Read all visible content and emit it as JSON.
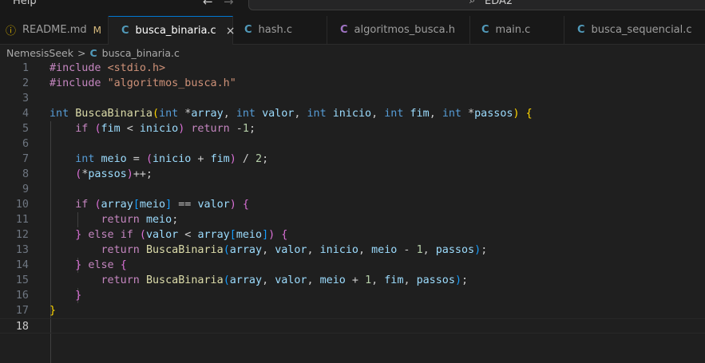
{
  "titlebar": {
    "menu_help": "Help",
    "back_icon": "←",
    "forward_icon": "→",
    "search_icon": "⌕",
    "command_center_text": "EDA2"
  },
  "tabs": [
    {
      "icon": "ⓘ",
      "label": "README.md",
      "badge": "M"
    },
    {
      "icon": "C",
      "label": "busca_binaria.c",
      "close": "×"
    },
    {
      "icon": "C",
      "label": "hash.c"
    },
    {
      "icon": "C",
      "label": "algoritmos_busca.h"
    },
    {
      "icon": "C",
      "label": "main.c"
    },
    {
      "icon": "C",
      "label": "busca_sequencial.c"
    }
  ],
  "breadcrumb": {
    "folder": "NemesisSeek",
    "separator": ">",
    "file_icon": "C",
    "file": "busca_binaria.c"
  },
  "editor": {
    "current_line": 18,
    "lines": [
      [
        [
          "#include ",
          "pre"
        ],
        [
          "<stdio.h>",
          "inc"
        ]
      ],
      [
        [
          "#include ",
          "pre"
        ],
        [
          "\"algoritmos_busca.h\"",
          "inc"
        ]
      ],
      [],
      [
        [
          "int",
          "kw"
        ],
        [
          " ",
          "txt"
        ],
        [
          "BuscaBinaria",
          "fn"
        ],
        [
          "(",
          "p1"
        ],
        [
          "int",
          "kw"
        ],
        [
          " *",
          "txt"
        ],
        [
          "array",
          "var"
        ],
        [
          ", ",
          "txt"
        ],
        [
          "int",
          "kw"
        ],
        [
          " ",
          "txt"
        ],
        [
          "valor",
          "var"
        ],
        [
          ", ",
          "txt"
        ],
        [
          "int",
          "kw"
        ],
        [
          " ",
          "txt"
        ],
        [
          "inicio",
          "var"
        ],
        [
          ", ",
          "txt"
        ],
        [
          "int",
          "kw"
        ],
        [
          " ",
          "txt"
        ],
        [
          "fim",
          "var"
        ],
        [
          ", ",
          "txt"
        ],
        [
          "int",
          "kw"
        ],
        [
          " *",
          "txt"
        ],
        [
          "passos",
          "var"
        ],
        [
          ")",
          "p1"
        ],
        [
          " ",
          "txt"
        ],
        [
          "{",
          "p1"
        ]
      ],
      [
        [
          "    ",
          "txt"
        ],
        [
          "if",
          "ctl"
        ],
        [
          " ",
          "txt"
        ],
        [
          "(",
          "p2"
        ],
        [
          "fim",
          "var"
        ],
        [
          " < ",
          "txt"
        ],
        [
          "inicio",
          "var"
        ],
        [
          ")",
          "p2"
        ],
        [
          " ",
          "txt"
        ],
        [
          "return",
          "ctl"
        ],
        [
          " -",
          "txt"
        ],
        [
          "1",
          "num"
        ],
        [
          ";",
          "txt"
        ]
      ],
      [],
      [
        [
          "    ",
          "txt"
        ],
        [
          "int",
          "kw"
        ],
        [
          " ",
          "txt"
        ],
        [
          "meio",
          "var"
        ],
        [
          " = ",
          "txt"
        ],
        [
          "(",
          "p2"
        ],
        [
          "inicio",
          "var"
        ],
        [
          " + ",
          "txt"
        ],
        [
          "fim",
          "var"
        ],
        [
          ")",
          "p2"
        ],
        [
          " / ",
          "txt"
        ],
        [
          "2",
          "num"
        ],
        [
          ";",
          "txt"
        ]
      ],
      [
        [
          "    ",
          "txt"
        ],
        [
          "(",
          "p2"
        ],
        [
          "*",
          "txt"
        ],
        [
          "passos",
          "var"
        ],
        [
          ")",
          "p2"
        ],
        [
          "++;",
          "txt"
        ]
      ],
      [],
      [
        [
          "    ",
          "txt"
        ],
        [
          "if",
          "ctl"
        ],
        [
          " ",
          "txt"
        ],
        [
          "(",
          "p2"
        ],
        [
          "array",
          "var"
        ],
        [
          "[",
          "p3"
        ],
        [
          "meio",
          "var"
        ],
        [
          "]",
          "p3"
        ],
        [
          " == ",
          "txt"
        ],
        [
          "valor",
          "var"
        ],
        [
          ")",
          "p2"
        ],
        [
          " ",
          "txt"
        ],
        [
          "{",
          "p2"
        ]
      ],
      [
        [
          "        ",
          "txt"
        ],
        [
          "return",
          "ctl"
        ],
        [
          " ",
          "txt"
        ],
        [
          "meio",
          "var"
        ],
        [
          ";",
          "txt"
        ]
      ],
      [
        [
          "    ",
          "txt"
        ],
        [
          "}",
          "p2"
        ],
        [
          " ",
          "txt"
        ],
        [
          "else",
          "ctl"
        ],
        [
          " ",
          "txt"
        ],
        [
          "if",
          "ctl"
        ],
        [
          " ",
          "txt"
        ],
        [
          "(",
          "p2"
        ],
        [
          "valor",
          "var"
        ],
        [
          " < ",
          "txt"
        ],
        [
          "array",
          "var"
        ],
        [
          "[",
          "p3"
        ],
        [
          "meio",
          "var"
        ],
        [
          "]",
          "p3"
        ],
        [
          ")",
          "p2"
        ],
        [
          " ",
          "txt"
        ],
        [
          "{",
          "p2"
        ]
      ],
      [
        [
          "        ",
          "txt"
        ],
        [
          "return",
          "ctl"
        ],
        [
          " ",
          "txt"
        ],
        [
          "BuscaBinaria",
          "fn"
        ],
        [
          "(",
          "p3"
        ],
        [
          "array",
          "var"
        ],
        [
          ", ",
          "txt"
        ],
        [
          "valor",
          "var"
        ],
        [
          ", ",
          "txt"
        ],
        [
          "inicio",
          "var"
        ],
        [
          ", ",
          "txt"
        ],
        [
          "meio",
          "var"
        ],
        [
          " - ",
          "txt"
        ],
        [
          "1",
          "num"
        ],
        [
          ", ",
          "txt"
        ],
        [
          "passos",
          "var"
        ],
        [
          ")",
          "p3"
        ],
        [
          ";",
          "txt"
        ]
      ],
      [
        [
          "    ",
          "txt"
        ],
        [
          "}",
          "p2"
        ],
        [
          " ",
          "txt"
        ],
        [
          "else",
          "ctl"
        ],
        [
          " ",
          "txt"
        ],
        [
          "{",
          "p2"
        ]
      ],
      [
        [
          "        ",
          "txt"
        ],
        [
          "return",
          "ctl"
        ],
        [
          " ",
          "txt"
        ],
        [
          "BuscaBinaria",
          "fn"
        ],
        [
          "(",
          "p3"
        ],
        [
          "array",
          "var"
        ],
        [
          ", ",
          "txt"
        ],
        [
          "valor",
          "var"
        ],
        [
          ", ",
          "txt"
        ],
        [
          "meio",
          "var"
        ],
        [
          " + ",
          "txt"
        ],
        [
          "1",
          "num"
        ],
        [
          ", ",
          "txt"
        ],
        [
          "fim",
          "var"
        ],
        [
          ", ",
          "txt"
        ],
        [
          "passos",
          "var"
        ],
        [
          ")",
          "p3"
        ],
        [
          ";",
          "txt"
        ]
      ],
      [
        [
          "    ",
          "txt"
        ],
        [
          "}",
          "p2"
        ]
      ],
      [
        [
          "}",
          "p1"
        ]
      ],
      []
    ]
  }
}
